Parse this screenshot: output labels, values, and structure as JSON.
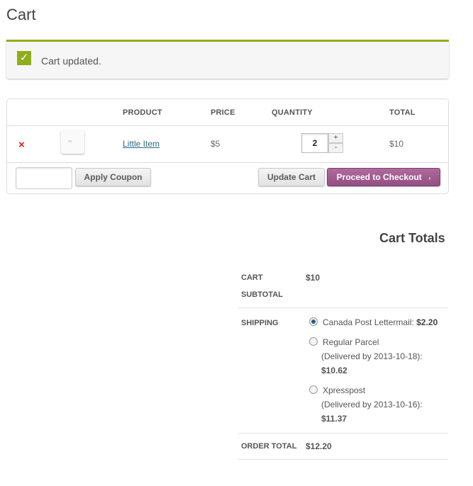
{
  "page": {
    "title": "Cart"
  },
  "notice": {
    "icon": "checkmark-icon",
    "message": "Cart updated.",
    "accent": "#8fae1b"
  },
  "cart_table": {
    "headers": {
      "product": "PRODUCT",
      "price": "PRICE",
      "quantity": "QUANTITY",
      "total": "TOTAL"
    },
    "rows": [
      {
        "remove_icon": "×",
        "thumbnail_icon": "placeholder-image-icon",
        "product": "Little Item",
        "price": "$5",
        "quantity": "2",
        "total": "$10"
      }
    ],
    "qty_plus": "+",
    "qty_minus": "-"
  },
  "actions": {
    "coupon_value": "",
    "apply_coupon": "Apply Coupon",
    "update_cart": "Update Cart",
    "checkout": "Proceed to Checkout",
    "checkout_arrow": "›",
    "checkout_color": "#a46497"
  },
  "totals": {
    "title": "Cart Totals",
    "subtotal_label_1": "CART",
    "subtotal_label_2": "SUBTOTAL",
    "subtotal_value": "$10",
    "shipping_label": "SHIPPING",
    "shipping_options": [
      {
        "name": "Canada Post Lettermail:",
        "price": "$2.20",
        "selected": true
      },
      {
        "name": "Regular Parcel",
        "detail": "(Delivered by 2013-10-18):",
        "price": "$10.62",
        "selected": false
      },
      {
        "name": "Xpresspost",
        "detail": "(Delivered by 2013-10-16):",
        "price": "$11.37",
        "selected": false
      }
    ],
    "order_total_label": "ORDER TOTAL",
    "order_total_value": "$12.20"
  }
}
